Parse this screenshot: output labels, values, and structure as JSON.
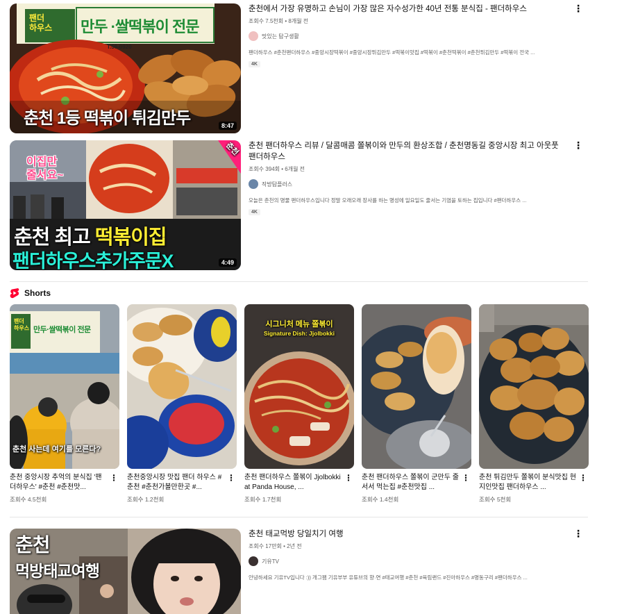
{
  "videos": [
    {
      "title": "춘천에서 가장 유명하고 손님이 가장 많은 자수성가한 40년 전통 분식집 - 팬더하우스",
      "stats": "조회수 7.5천회 • 8개월 전",
      "channel": "맛있는 탐구생활",
      "description": "팬더하우스 #춘천팬더하우스 #중앙시장떡볶이 #중앙시장튀김만두 #떡볶이맛집 #떡볶이 #춘천떡볶이 #춘천튀김만두 #떡볶이 전국 ...",
      "badge": "4K",
      "duration": "8:47",
      "thumb_sign_left": "팬더\n하우스",
      "thumb_sign_main": "만두 ·쌀떡볶이 전문",
      "thumb_phone": "T.56-0920",
      "thumb_caption": "춘천 1등 떡볶이 튀김만두"
    },
    {
      "title": "춘천 팬더하우스 리뷰 / 달콤매콤 쫄볶이와 만두의 환상조합 / 춘천명동길 중앙시장 최고 아웃풋 팬더하우스",
      "stats": "조회수 394회 • 6개월 전",
      "channel": "작방탐플러스",
      "description": "오늘은 춘천의 명물 팬더하우스입니다 정말 오래오래 장사를 하는 명성에 일요일도 줄서는 기염을 토하는 집입니다 #팬더하우스 ...",
      "badge": "4K",
      "duration": "4:49",
      "thumb_bubble": "이집만\n줄서요~",
      "thumb_ribbon": "춘천",
      "thumb_caption_1a": "춘천 최고 ",
      "thumb_caption_1b": "떡볶이집",
      "thumb_caption_2": "팬더하우스추가주문X"
    },
    {
      "title": "춘천 태교먹방 당일치기 여행",
      "stats": "조회수 17만회 • 2년 전",
      "channel": "기유TV",
      "description": "안녕하세요 기유TV입니다 :)) 개그팸 기유부부 유튜브의 향·연 #태교여행 #춘천 #육림랜드 #진아하우스 #명동구리 #팬더하우스 ...",
      "thumb_caption_1": "춘천",
      "thumb_caption_2": "먹방태교여행"
    }
  ],
  "shorts_section": {
    "label": "Shorts",
    "items": [
      {
        "title": "춘천 중앙시장 추억의 분식집 '팬더하우스' #춘천 #춘천맛...",
        "views": "조회수 4.5천회",
        "overlay": "춘천 사는데 여기를 모른다?",
        "sign": "만두·쌀떡볶이 전문",
        "sign_left": "팬더\n하우스"
      },
      {
        "title": "춘천중앙시장 맛집 팬더 하우스 #춘천 #춘천가볼만한곳 #...",
        "views": "조회수 1.2천회"
      },
      {
        "title": "춘천 팬더하우스 쫄볶이 Jjolbokki at Panda House, ...",
        "views": "조회수 1.7천회",
        "overlay_ko": "시그니처 메뉴 쫄볶이",
        "overlay_en": "Signature Dish: Jjolbokki"
      },
      {
        "title": "춘천 팬더하우스 쫄볶이 군만두 줄서서 먹는집 #춘천맛집 ...",
        "views": "조회수 1.4천회"
      },
      {
        "title": "춘천 튀김만두 쫄볶이 분식맛집 현지인맛집 팬더하우스 ...",
        "views": "조회수 5천회"
      }
    ]
  },
  "colors": {
    "shorts_red": "#ff0033",
    "text_primary": "#0f0f0f",
    "text_secondary": "#606060",
    "divider": "#e5e5e5"
  },
  "icons": {
    "more": "more-vertical-icon",
    "shorts": "shorts-logo-icon"
  }
}
